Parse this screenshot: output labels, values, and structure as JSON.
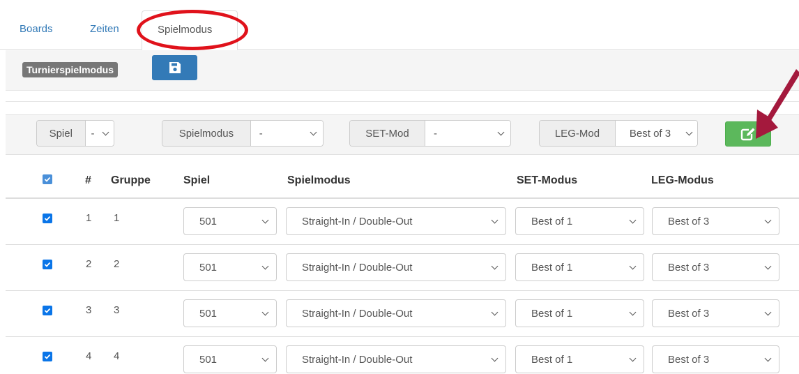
{
  "tabs": [
    {
      "label": "Boards"
    },
    {
      "label": "Zeiten"
    },
    {
      "label": "Spielmodus"
    }
  ],
  "header": {
    "label": "Turnierspielmodus",
    "save_icon": "floppy-disk-icon"
  },
  "filters": {
    "spiel": {
      "label": "Spiel",
      "value": "-"
    },
    "spielmodus": {
      "label": "Spielmodus",
      "value": "-"
    },
    "set_mod": {
      "label": "SET-Mod",
      "value": "-"
    },
    "leg_mod": {
      "label": "LEG-Mod",
      "value": "Best of 3"
    },
    "edit_icon": "edit-icon"
  },
  "table": {
    "headers": {
      "num": "#",
      "gruppe": "Gruppe",
      "spiel": "Spiel",
      "spielmodus": "Spielmodus",
      "set_modus": "SET-Modus",
      "leg_modus": "LEG-Modus"
    },
    "rows": [
      {
        "num": "1",
        "gruppe": "1",
        "spiel": "501",
        "spielmodus": "Straight-In / Double-Out",
        "set_modus": "Best of 1",
        "leg_modus": "Best of 3",
        "checked": true
      },
      {
        "num": "2",
        "gruppe": "2",
        "spiel": "501",
        "spielmodus": "Straight-In / Double-Out",
        "set_modus": "Best of 1",
        "leg_modus": "Best of 3",
        "checked": true
      },
      {
        "num": "3",
        "gruppe": "3",
        "spiel": "501",
        "spielmodus": "Straight-In / Double-Out",
        "set_modus": "Best of 1",
        "leg_modus": "Best of 3",
        "checked": true
      },
      {
        "num": "4",
        "gruppe": "4",
        "spiel": "501",
        "spielmodus": "Straight-In / Double-Out",
        "set_modus": "Best of 1",
        "leg_modus": "Best of 3",
        "checked": true
      }
    ]
  },
  "colors": {
    "link": "#337ab7",
    "primary": "#337ab7",
    "success": "#5cb85c",
    "highlight_ellipse": "#e0121b",
    "arrow": "#a4193d"
  }
}
